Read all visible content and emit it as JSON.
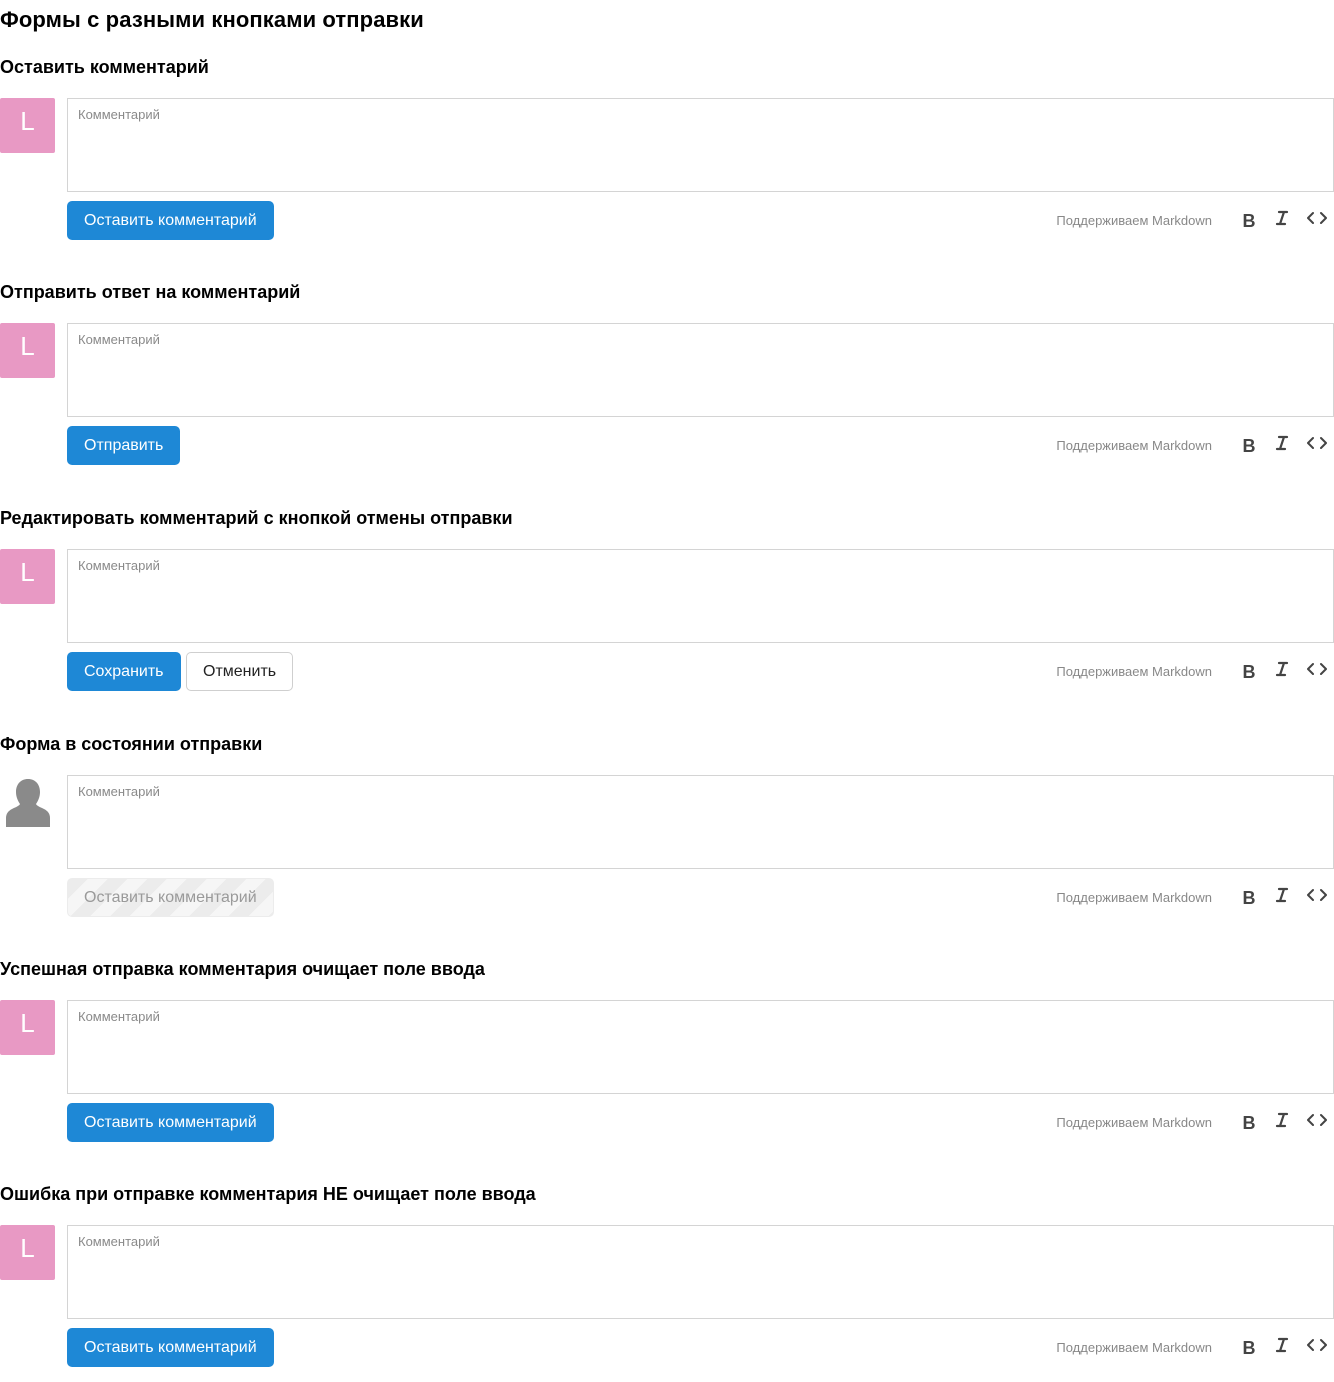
{
  "page": {
    "title": "Формы с разными кнопками отправки"
  },
  "common": {
    "placeholder": "Комментарий",
    "markdown_hint": "Поддерживаем Markdown",
    "avatar_letter": "L",
    "avatar_color": "#e899c4",
    "primary_color": "#1e88d6"
  },
  "sections": [
    {
      "title": "Оставить комментарий",
      "avatar": "letter",
      "submit_label": "Оставить комментарий",
      "state": "default"
    },
    {
      "title": "Отправить ответ на комментарий",
      "avatar": "letter",
      "submit_label": "Отправить",
      "state": "default"
    },
    {
      "title": "Редактировать комментарий с кнопкой отмены отправки",
      "avatar": "letter",
      "submit_label": "Сохранить",
      "cancel_label": "Отменить",
      "state": "default"
    },
    {
      "title": "Форма в состоянии отправки",
      "avatar": "user-silhouette-icon",
      "submit_label": "Оставить комментарий",
      "state": "submitting"
    },
    {
      "title": "Успешная отправка комментария очищает поле ввода",
      "avatar": "letter",
      "submit_label": "Оставить комментарий",
      "state": "default"
    },
    {
      "title": "Ошибка при отправке комментария НЕ очищает поле ввода",
      "avatar": "letter",
      "submit_label": "Оставить комментарий",
      "state": "default"
    }
  ],
  "toolbar_icons": [
    "bold-icon",
    "italic-icon",
    "code-icon"
  ]
}
